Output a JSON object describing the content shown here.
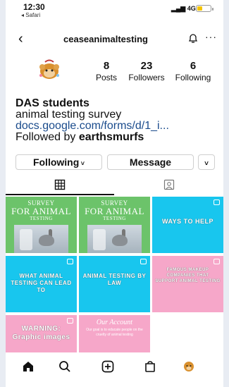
{
  "status": {
    "time": "12:30",
    "back_app": "◂ Safari",
    "network": "4G"
  },
  "header": {
    "username": "ceaseanimaltesting",
    "back_icon": "chevron-left-icon",
    "bell_icon": "bell-icon",
    "more_icon": "more-icon"
  },
  "profile": {
    "stats": [
      {
        "value": "8",
        "label": "Posts"
      },
      {
        "value": "23",
        "label": "Followers"
      },
      {
        "value": "6",
        "label": "Following"
      }
    ],
    "name": "DAS students",
    "bio": "animal testing survey",
    "link": "docs.google.com/forms/d/1_i...",
    "followed_prefix": "Followed by ",
    "followed_user": "earthsmurfs"
  },
  "actions": {
    "following": "Following",
    "message": "Message"
  },
  "tabs": [
    {
      "icon": "grid-icon"
    },
    {
      "icon": "tagged-icon"
    }
  ],
  "colors": {
    "green": "#6cc36a",
    "cyan": "#18c6ee",
    "pink": "#f6a7c9",
    "link": "#1a4b8c"
  },
  "posts": [
    {
      "line1": "SURVEY",
      "line2": "FOR ANIMAL",
      "line3": "TESTING"
    },
    {
      "line1": "SURVEY",
      "line2": "FOR ANIMAL",
      "line3": "TESTING"
    },
    {
      "text": "WAYS TO HELP"
    },
    {
      "text": "WHAT ANIMAL TESTING CAN LEAD TO"
    },
    {
      "text": "ANIMAL TESTING BY LAW"
    },
    {
      "text": "FAMOUS MAKEUP COMPANIES THAT SUPPORT ANIMAL TESTING"
    },
    {
      "text": "WARNING: Graphic images"
    },
    {
      "title": "Our Account",
      "body": "Our goal is to educate people on the cruelty of animal testing"
    }
  ],
  "bottom_nav": [
    "home-icon",
    "search-icon",
    "new-post-icon",
    "shop-icon",
    "profile-icon"
  ]
}
